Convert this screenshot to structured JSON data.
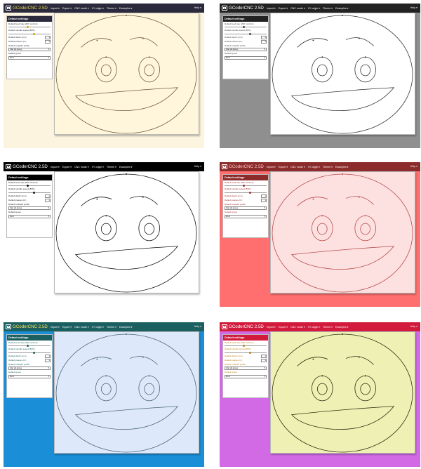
{
  "app": {
    "title": "GCoderCNC 2.5D",
    "menu": [
      "Import ▾",
      "Export ▾",
      "CNC mode ▾",
      "XY origin ▾",
      "Theme ▾",
      "Examples ▾"
    ],
    "help": "Help ▾"
  },
  "settings": {
    "header": "Default settings",
    "feed_label": "Default feed rate (200 mm/min)",
    "speed_label": "Default spindle speed (80%)",
    "depth_label": "Default depth (mm)",
    "depth_value": "1",
    "passes_label": "Default passes (nr)",
    "passes_value": "1",
    "profile_label": "Default toolpath profile",
    "profile_value": "Flat all along",
    "group_label": "Default group",
    "group_value": "Red",
    "feed_level": 0.45,
    "speed_level": 0.6
  },
  "themes": [
    {
      "nav": "#2a2a3c",
      "brand": "#e8d44a",
      "page": "#fdf4df",
      "canvas": "#fff6dc",
      "stroke": "#6b5c40",
      "label": "#2a2a3c",
      "accent": "#c9a300"
    },
    {
      "nav": "#222222",
      "brand": "#ffffff",
      "page": "#8f8f8f",
      "canvas": "#ffffff",
      "stroke": "#333333",
      "label": "#444444",
      "accent": "#444444"
    },
    {
      "nav": "#000000",
      "brand": "#ffffff",
      "page": "#ffffff",
      "canvas": "#ffffff",
      "stroke": "#111111",
      "label": "#222222",
      "accent": "#111111"
    },
    {
      "nav": "#8c2b2b",
      "brand": "#ffc7c7",
      "page": "#ff6f6f",
      "canvas": "#fde1e1",
      "stroke": "#b84a4a",
      "label": "#9b2e2e",
      "accent": "#9b2e2e"
    },
    {
      "nav": "#1b5f60",
      "brand": "#ffe15a",
      "page": "#1a8ed6",
      "canvas": "#dde9fb",
      "stroke": "#4e6478",
      "label": "#1b5f60",
      "accent": "#1b5f60"
    },
    {
      "nav": "#d11a3c",
      "brand": "#ffffff",
      "page": "#d26ae6",
      "canvas": "#eef0b4",
      "stroke": "#2e2e10",
      "label": "#b8801c",
      "accent": "#b8801c"
    }
  ]
}
